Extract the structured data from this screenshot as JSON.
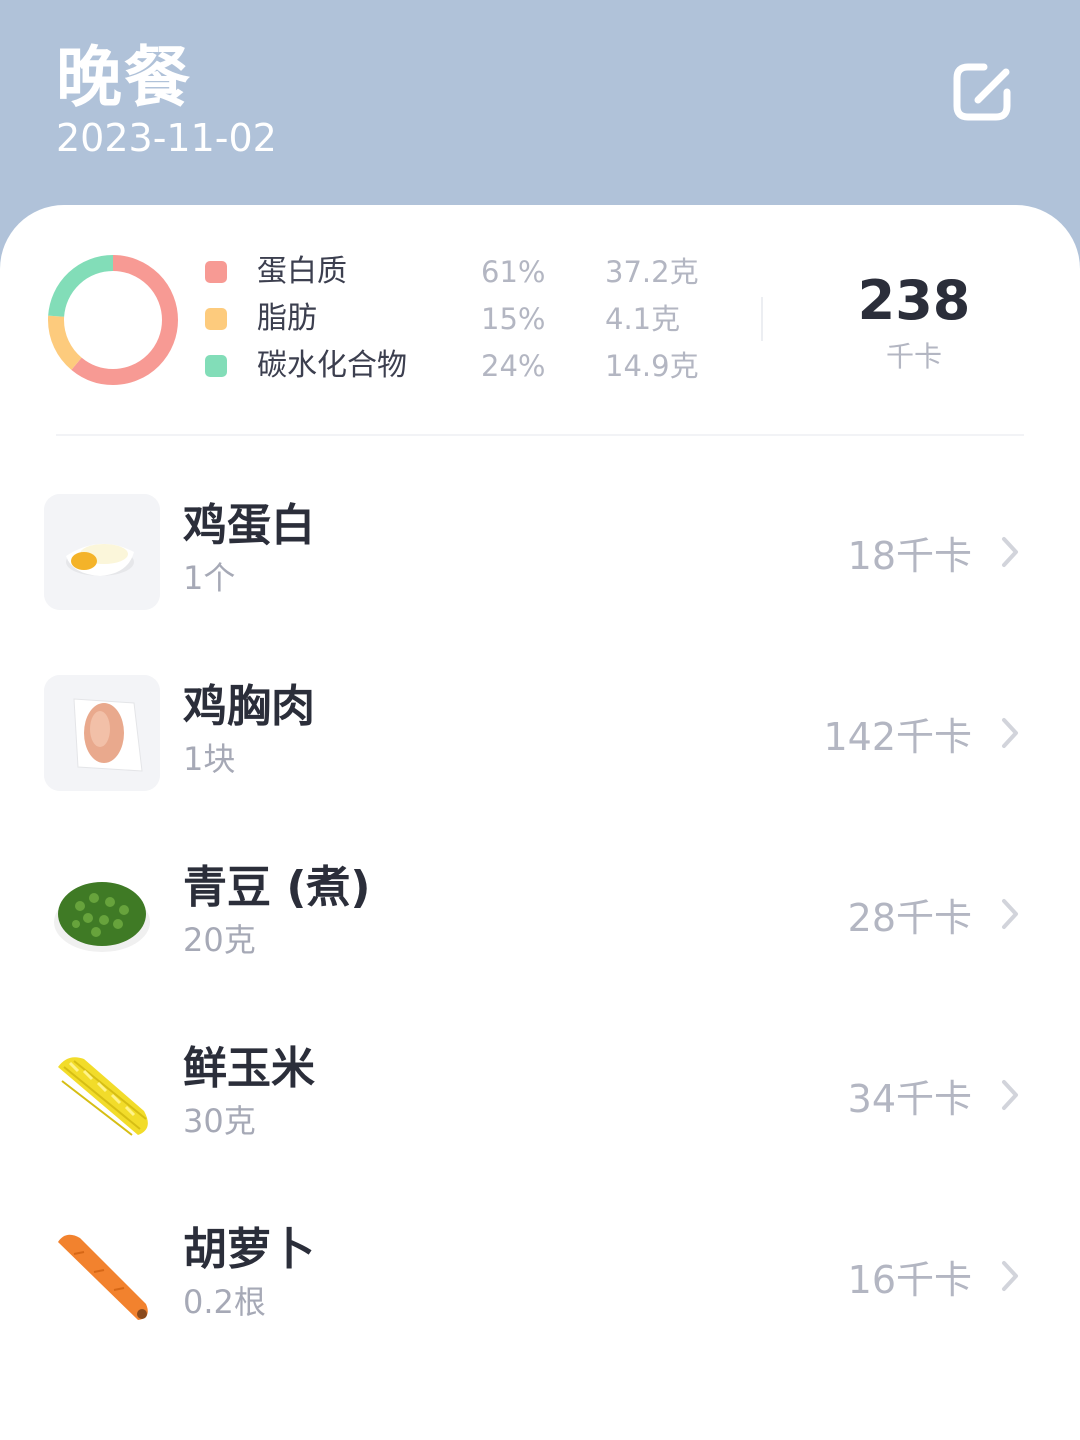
{
  "header": {
    "title": "晚餐",
    "date": "2023-11-02"
  },
  "summary": {
    "macros": [
      {
        "name": "蛋白质",
        "percent": "61%",
        "grams": "37.2克",
        "color": "#f79a94"
      },
      {
        "name": "脂肪",
        "percent": "15%",
        "grams": "4.1克",
        "color": "#fdcb7d"
      },
      {
        "name": "碳水化合物",
        "percent": "24%",
        "grams": "14.9克",
        "color": "#82ddb8"
      }
    ],
    "total_kcal": "238",
    "kcal_unit": "千卡"
  },
  "foods": [
    {
      "name": "鸡蛋白",
      "qty": "1个",
      "kcal": "18千卡",
      "icon": "egg-white-icon"
    },
    {
      "name": "鸡胸肉",
      "qty": "1块",
      "kcal": "142千卡",
      "icon": "chicken-breast-icon"
    },
    {
      "name": "青豆 (煮)",
      "qty": "20克",
      "kcal": "28千卡",
      "icon": "green-peas-icon"
    },
    {
      "name": "鲜玉米",
      "qty": "30克",
      "kcal": "34千卡",
      "icon": "corn-icon"
    },
    {
      "name": "胡萝卜",
      "qty": "0.2根",
      "kcal": "16千卡",
      "icon": "carrot-icon"
    }
  ]
}
